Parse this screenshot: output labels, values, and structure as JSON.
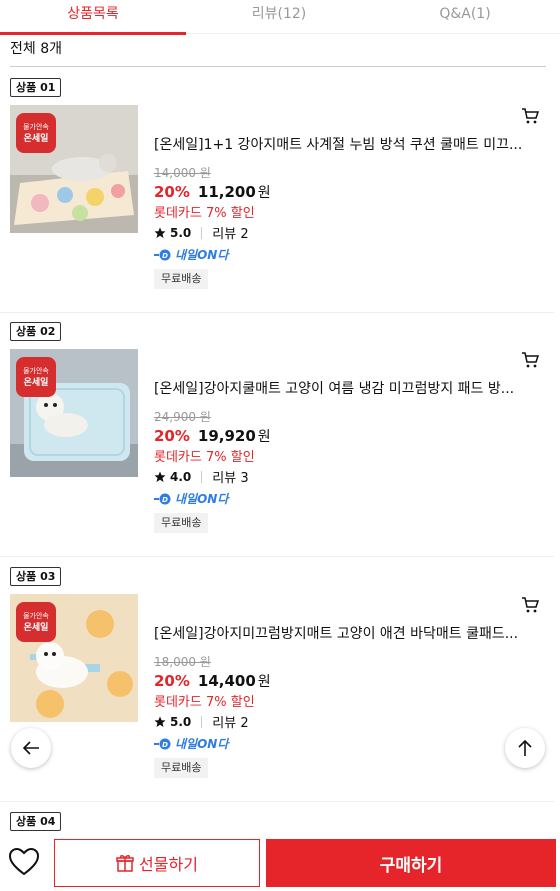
{
  "tabs": [
    {
      "label": "상품목록"
    },
    {
      "label": "리뷰(12)"
    },
    {
      "label": "Q&A(1)"
    }
  ],
  "total_label": "전체 8개",
  "thumb_sticker": {
    "line1": "물가안속",
    "line2": "온세일"
  },
  "products": [
    {
      "badge": "상품 01",
      "title": "[온세일]1+1 강아지매트 사계절 누빔 방석 쿠션 쿨매트 미끄...",
      "original_price": "14,000 원",
      "discount": "20%",
      "price": "11,200",
      "currency": "원",
      "card_discount": "롯데카드 7% 할인",
      "rating": "5.0",
      "reviews": "리뷰 2",
      "delivery": "내일ON다",
      "free_shipping": "무료배송"
    },
    {
      "badge": "상품 02",
      "title": "[온세일]강아지쿨매트 고양이 여름 냉감 미끄럼방지 패드 방...",
      "original_price": "24,900 원",
      "discount": "20%",
      "price": "19,920",
      "currency": "원",
      "card_discount": "롯데카드 7% 할인",
      "rating": "4.0",
      "reviews": "리뷰 3",
      "delivery": "내일ON다",
      "free_shipping": "무료배송"
    },
    {
      "badge": "상품 03",
      "title": "[온세일]강아지미끄럼방지매트 고양이 애견 바닥매트 쿨패드...",
      "original_price": "18,000 원",
      "discount": "20%",
      "price": "14,400",
      "currency": "원",
      "card_discount": "롯데카드 7% 할인",
      "rating": "5.0",
      "reviews": "리뷰 2",
      "delivery": "내일ON다",
      "free_shipping": "무료배송"
    },
    {
      "badge": "상품 04"
    }
  ],
  "bottom_bar": {
    "gift_label": "선물하기",
    "buy_label": "구매하기"
  },
  "colors": {
    "accent": "#e5252a",
    "delivery_blue": "#2e7de1"
  },
  "icons": [
    "cart-icon",
    "star-icon",
    "delivery-icon",
    "back-arrow-icon",
    "scroll-top-icon",
    "heart-icon",
    "gift-icon"
  ]
}
